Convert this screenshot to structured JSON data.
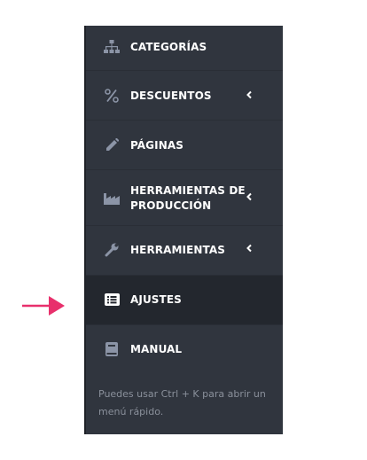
{
  "menu": {
    "items": [
      {
        "label": "CATEGORÍAS",
        "icon": "sitemap-icon"
      },
      {
        "label": "DESCUENTOS",
        "icon": "percent-icon",
        "chevron": true
      },
      {
        "label": "PÁGINAS",
        "icon": "pencil-icon"
      },
      {
        "label": "HERRAMIENTAS DE PRODUCCIÓN",
        "icon": "factory-icon",
        "chevron": true
      },
      {
        "label": "HERRAMIENTAS",
        "icon": "wrench-icon",
        "chevron": true
      },
      {
        "label": "AJUSTES",
        "icon": "list-icon",
        "active": true
      },
      {
        "label": "MANUAL",
        "icon": "book-icon"
      }
    ],
    "hint": "Puedes usar Ctrl + K para abrir un menú rápido."
  },
  "colors": {
    "sidebar_bg": "#30353e",
    "active_bg": "#23272e",
    "icon": "#8b94a6",
    "arrow": "#e8306c"
  }
}
